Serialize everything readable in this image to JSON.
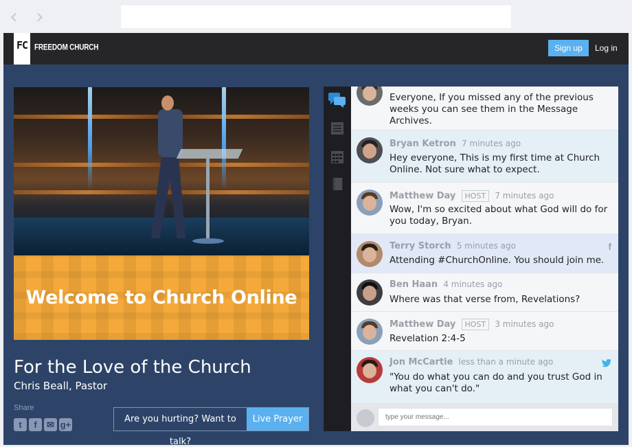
{
  "browser": {
    "back_icon": "chevron-left-icon",
    "forward_icon": "chevron-right-icon"
  },
  "header": {
    "logo_mark": "FC",
    "logo_text": "FREEDOM CHURCH",
    "signup_label": "Sign up",
    "login_label": "Log in"
  },
  "video": {
    "overlay_text": "Welcome to Church Online"
  },
  "sermon": {
    "title": "For the Love of the Church",
    "speaker": "Chris Beall, Pastor"
  },
  "share": {
    "label": "Share",
    "icons": [
      "twitter-icon",
      "facebook-icon",
      "email-icon",
      "google-plus-icon"
    ]
  },
  "prayer": {
    "prompt": "Are you hurting? Want to talk?",
    "button": "Live Prayer"
  },
  "chat_rail": {
    "icons": [
      "chat-icon",
      "notes-icon",
      "calendar-icon",
      "bible-icon"
    ]
  },
  "chat": {
    "messages": [
      {
        "name": "",
        "host": "",
        "time": "",
        "body": "Everyone, If you missed any of the previous weeks you can see them in the Message Archives."
      },
      {
        "name": "Bryan Ketron",
        "host": "",
        "time": "7 minutes ago",
        "body": "Hey everyone, This is my first time at Church Online. Not sure what to expect."
      },
      {
        "name": "Matthew Day",
        "host": "HOST",
        "time": "7 minutes ago",
        "body": "Wow, I'm so excited about what God will do for you today, Bryan."
      },
      {
        "name": "Terry Storch",
        "host": "",
        "time": "5 minutes ago",
        "body": "Attending #ChurchOnline. You should join me.",
        "social": "f"
      },
      {
        "name": "Ben Haan",
        "host": "",
        "time": "4 minutes ago",
        "body": "Where was that verse from, Revelations?"
      },
      {
        "name": "Matthew Day",
        "host": "HOST",
        "time": "3 minutes ago",
        "body": "Revelation 2:4-5"
      },
      {
        "name": "Jon McCartie",
        "host": "",
        "time": "less than a minute ago",
        "body": "\"You do what you can do and you trust God in what you can't do.\"",
        "social": "twitter"
      }
    ],
    "input_placeholder": "type your message..."
  },
  "colors": {
    "frame_bg": "#2d4468",
    "accent": "#5bb1ef",
    "topbar": "#262628"
  }
}
